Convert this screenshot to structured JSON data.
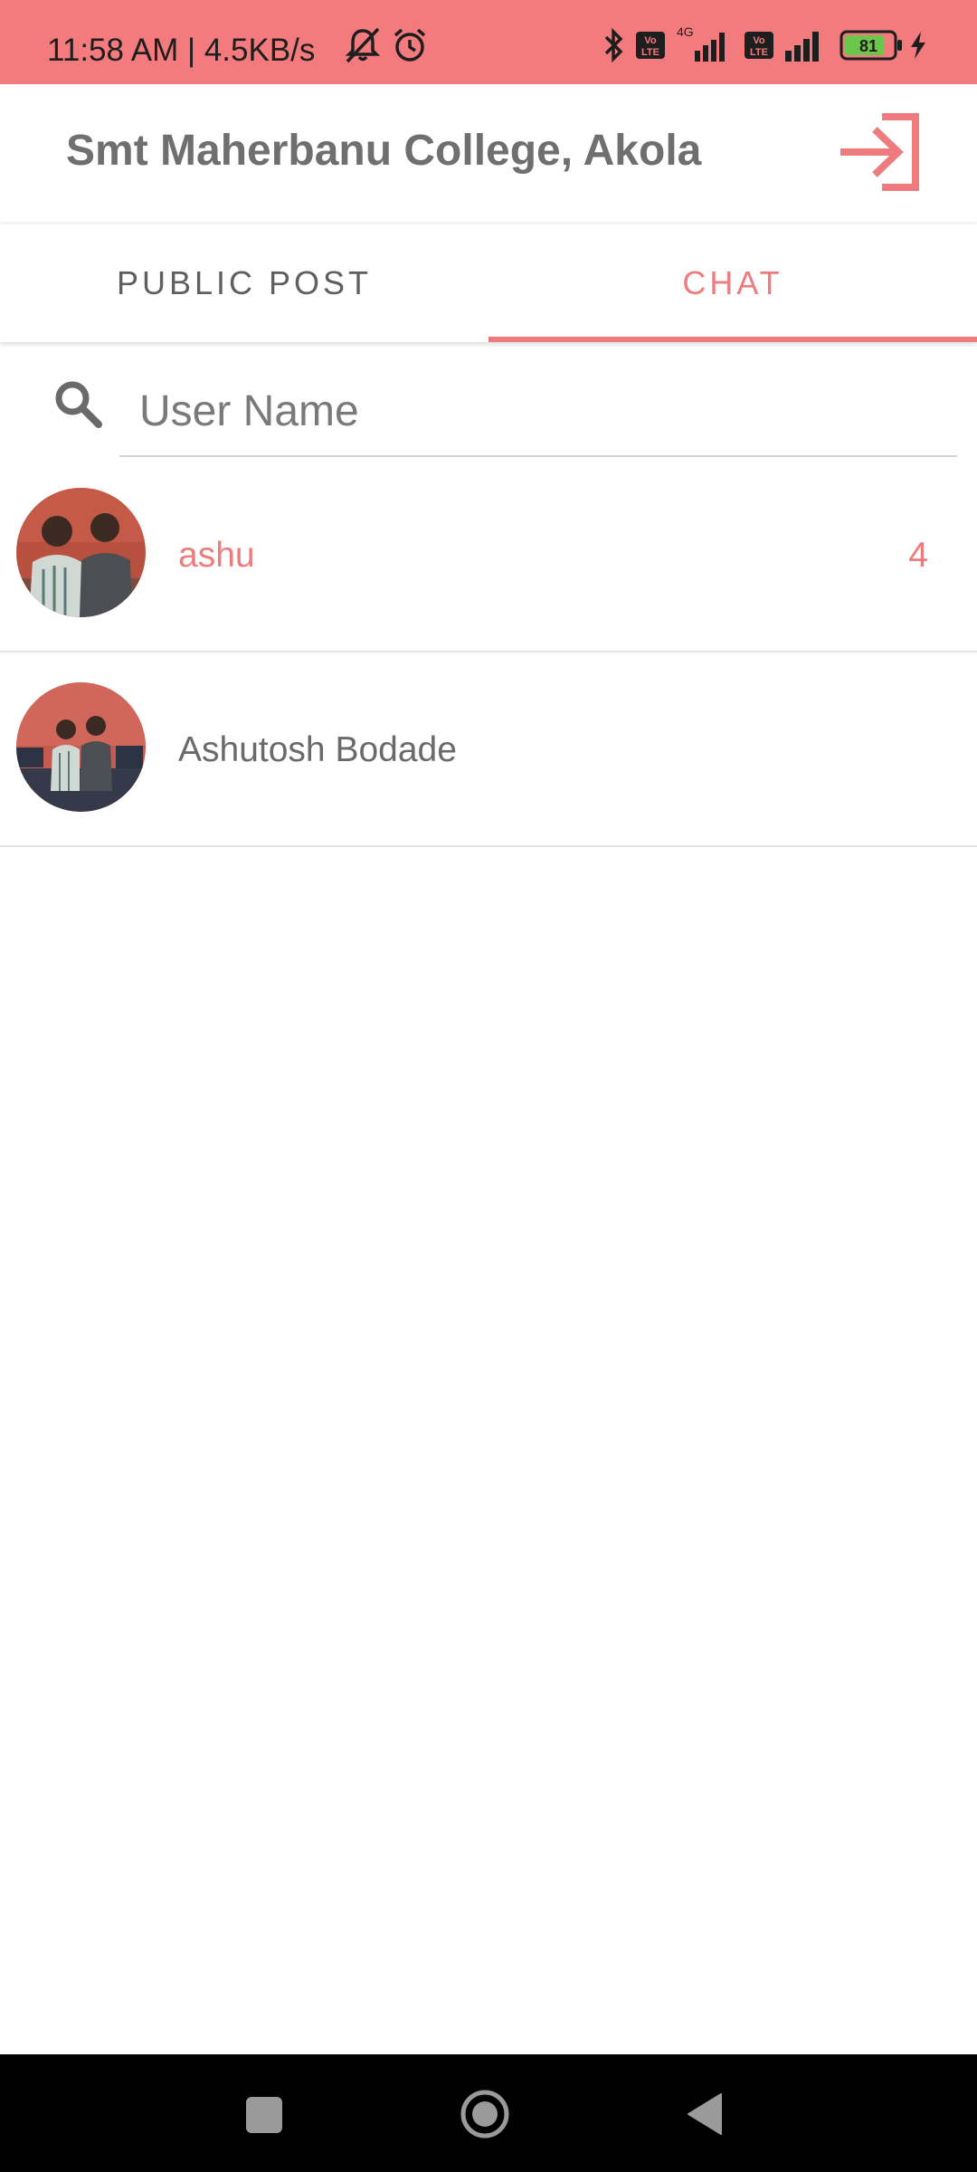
{
  "status_bar": {
    "time_text": "11:58 AM | 4.5KB/s",
    "network_label": "4G",
    "volte_label": "Vo LTE",
    "battery_level": "81",
    "background_color": "#f47b7d",
    "icons": [
      "bell-off-icon",
      "alarm-icon",
      "bluetooth-icon",
      "volte-icon",
      "signal-icon",
      "battery-icon",
      "charging-icon"
    ]
  },
  "app_bar": {
    "title": "Smt Maherbanu College, Akola",
    "logout_icon": "logout-icon"
  },
  "tabs": [
    {
      "label": "PUBLIC POST",
      "selected": false
    },
    {
      "label": "CHAT",
      "selected": true
    }
  ],
  "search": {
    "placeholder": "User Name",
    "value": "",
    "icon": "search-icon"
  },
  "chats": [
    {
      "name": "ashu",
      "unread_count": "4",
      "unread": true
    },
    {
      "name": "Ashutosh Bodade",
      "unread_count": "",
      "unread": false
    }
  ],
  "nav_bar": {
    "buttons": [
      "recents-button",
      "home-button",
      "back-button"
    ]
  },
  "colors": {
    "accent": "#ee7c7e",
    "title_text": "#6f6f6f",
    "divider": "#e3e3e3"
  }
}
